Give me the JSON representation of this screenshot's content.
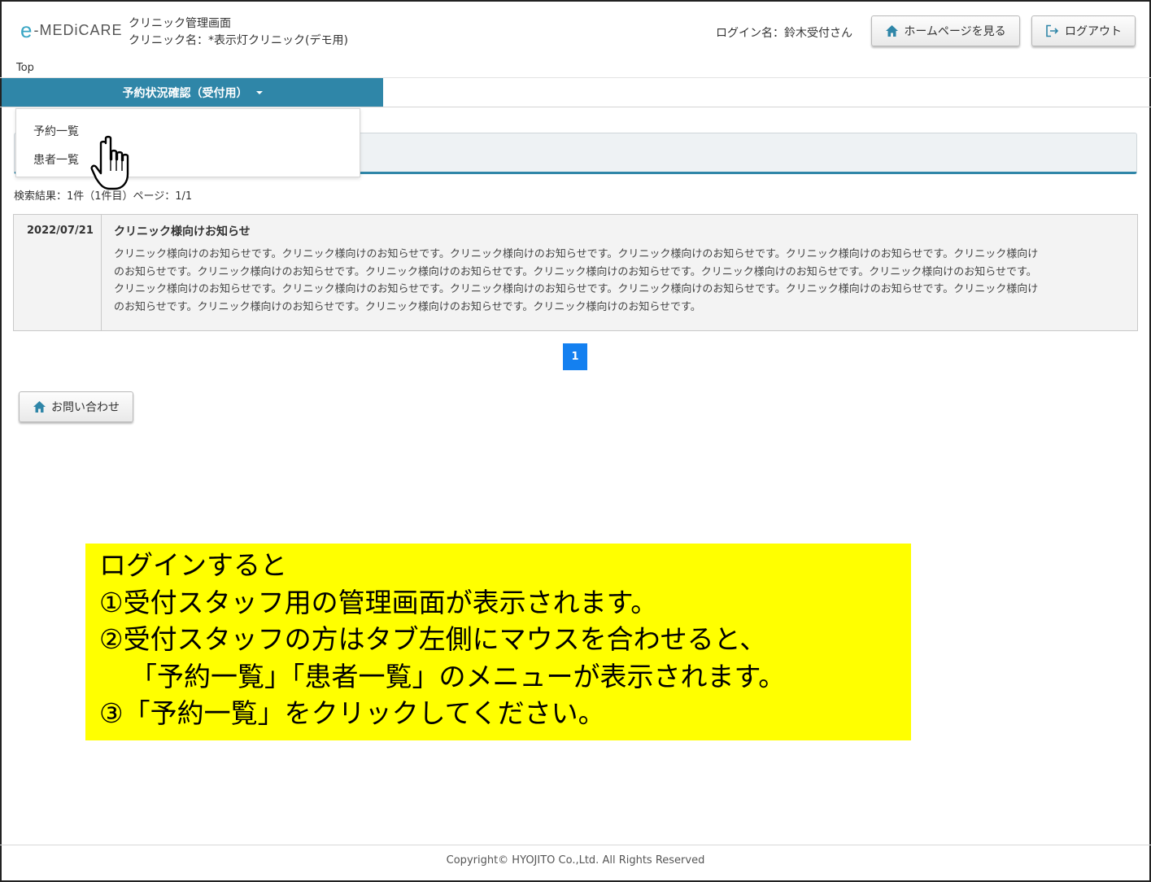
{
  "header": {
    "logo_e": "e",
    "logo_text": "-MEDiCARE",
    "title": "クリニック管理画面",
    "clinic_name": "クリニック名：*表示灯クリニック(デモ用)",
    "login_name": "ログイン名：鈴木受付さん",
    "home_button": "ホームページを見る",
    "logout_button": "ログアウト"
  },
  "breadcrumb": "Top",
  "nav": {
    "tab_label": "予約状況確認（受付用）",
    "dropdown_items": [
      "予約一覧",
      "患者一覧"
    ]
  },
  "results": {
    "summary": "検索結果：1件（1件目）ページ：1/1"
  },
  "notices": [
    {
      "date": "2022/07/21",
      "title": "クリニック様向けお知らせ",
      "lines": [
        "クリニック様向けのお知らせです。クリニック様向けのお知らせです。クリニック様向けのお知らせです。クリニック様向けのお知らせです。クリニック様向けのお知らせです。クリニック様向け",
        "のお知らせです。クリニック様向けのお知らせです。クリニック様向けのお知らせです。クリニック様向けのお知らせです。クリニック様向けのお知らせです。クリニック様向けのお知らせです。",
        "クリニック様向けのお知らせです。クリニック様向けのお知らせです。クリニック様向けのお知らせです。クリニック様向けのお知らせです。クリニック様向けのお知らせです。クリニック様向け",
        "のお知らせです。クリニック様向けのお知らせです。クリニック様向けのお知らせです。クリニック様向けのお知らせです。"
      ]
    }
  ],
  "pagination": {
    "current": "1"
  },
  "contact_button": "お問い合わせ",
  "annotation": {
    "lines": [
      "ログインすると",
      "①受付スタッフ用の管理画面が表示されます。",
      "②受付スタッフの方はタブ左側にマウスを合わせると、",
      "「予約一覧」「患者一覧」のメニューが表示されます。",
      "③「予約一覧」をクリックしてください。"
    ]
  },
  "footer": "Copyright© HYOJITO Co.,Ltd. All Rights Reserved",
  "colors": {
    "nav_tab": "#2f86a8",
    "pager_active": "#1480f0",
    "annotation_bg": "#ffff00",
    "logo_accent": "#3aa6c4"
  },
  "icons": {
    "home": "home-icon",
    "logout": "logout-icon",
    "cursor": "hand-pointer-icon"
  }
}
